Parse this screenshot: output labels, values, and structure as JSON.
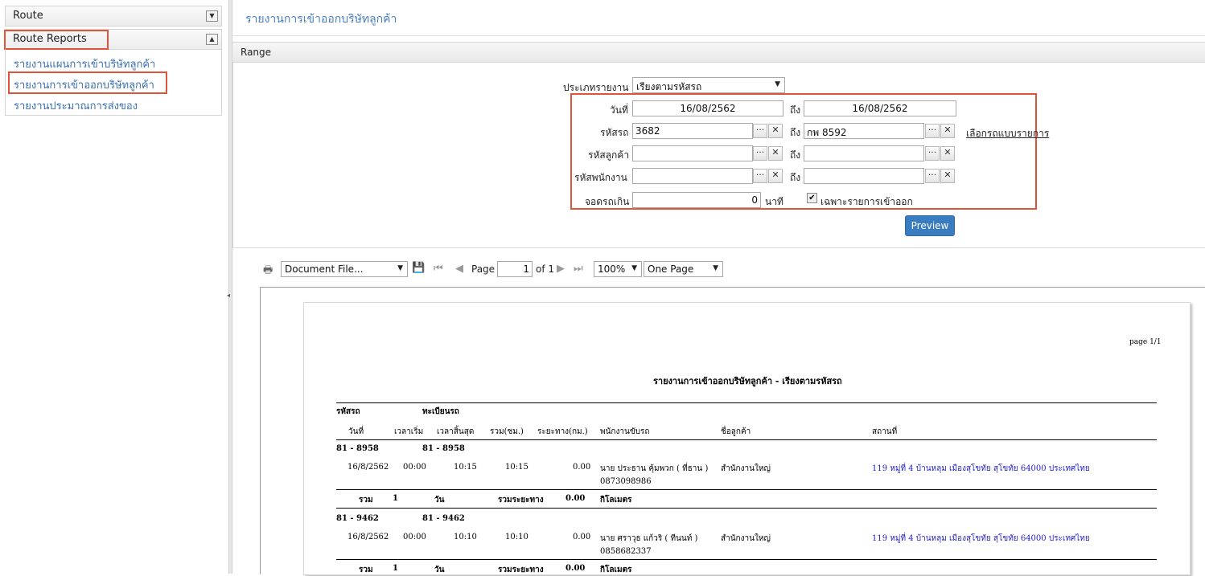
{
  "sidebar": {
    "route_title": "Route",
    "reports_title": "Route  Reports",
    "links": [
      "รายงานแผนการเข้าบริษัทลูกค้า",
      "รายงานการเข้าออกบริษัทลูกค้า",
      "รายงานประมาณการส่งของ"
    ]
  },
  "page_title": "รายงานการเข้าออกบริษัทลูกค้า",
  "range": {
    "header": "Range",
    "report_type_label": "ประเภทรายงาน",
    "report_type_value": "เรียงตามรหัสรถ",
    "date_label": "วันที่",
    "date_from": "16/08/2562",
    "date_to": "16/08/2562",
    "to_label": "ถึง",
    "car_label": "รหัสรถ",
    "car_from": "3682",
    "car_to": "กพ 8592",
    "customer_label": "รหัสลูกค้า",
    "employee_label": "รหัสพนักงาน",
    "park_label": "จอดรถเกิน",
    "park_value": "0",
    "minutes_label": "นาที",
    "only_inout_label": "เฉพาะรายการเข้าออก",
    "select_list_link": "เลือกรถแบบรายการ",
    "preview_label": "Preview",
    "ellipsis": "···",
    "clear": "✕"
  },
  "toolbar": {
    "print_icon": "printer-icon",
    "export_format": "Document File...",
    "page_label": "Page",
    "page_value": "1",
    "of_label": "of 1",
    "zoom": "100%",
    "view_mode": "One Page"
  },
  "report": {
    "page_info": "page 1/1",
    "title": "รายงานการเข้าออกบริษัทลูกค้า - เรียงตามรหัสรถ",
    "head1": [
      "รหัสรถ",
      "ทะเบียนรถ"
    ],
    "head2": [
      "วันที่",
      "เวลาเริ่ม",
      "เวลาสิ้นสุด",
      "รวม(ชม.)",
      "ระยะทาง(กม.)",
      "พนักงานขับรถ",
      "ชื่อลูกค้า",
      "สถานที่"
    ],
    "groups": [
      {
        "code": "81 - 8958",
        "plate": "81 - 8958",
        "row": [
          "16/8/2562",
          "00:00",
          "10:15",
          "10:15",
          "0.00",
          "นาย ประธาน คุ้มพวก ( ที่ธาน )",
          "สำนักงานใหญ่",
          "119 หมู่ที่ 4 บ้านหลุม เมืองสุโขทัย สุโขทัย 64000 ประเทศไทย"
        ],
        "phone": "0873098986",
        "sum": [
          "รวม",
          "1",
          "วัน",
          "รวมระยะทาง",
          "0.00",
          "กิโลเมตร"
        ]
      },
      {
        "code": "81 - 9462",
        "plate": "81 - 9462",
        "row": [
          "16/8/2562",
          "00:00",
          "10:10",
          "10:10",
          "0.00",
          "นาย ศราวุธ แก้วริ ( ทีนนท์ )",
          "สำนักงานใหญ่",
          "119 หมู่ที่ 4 บ้านหลุม เมืองสุโขทัย สุโขทัย 64000 ประเทศไทย"
        ],
        "phone": "0858682337",
        "sum": [
          "รวม",
          "1",
          "วัน",
          "รวมระยะทาง",
          "0.00",
          "กิโลเมตร"
        ]
      }
    ]
  }
}
